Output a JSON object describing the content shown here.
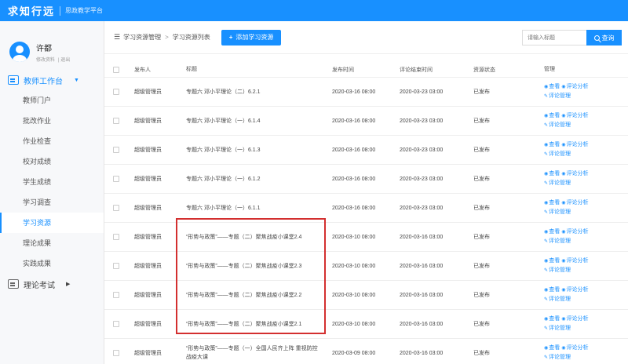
{
  "brand": {
    "title": "求知行远",
    "subtitle": "思政教学平台"
  },
  "user": {
    "name": "许都",
    "link_profile": "修改资料",
    "link_logout": "退出"
  },
  "sidebar": {
    "group_label": "教师工作台",
    "items": [
      {
        "label": "教师门户"
      },
      {
        "label": "批改作业"
      },
      {
        "label": "作业检查"
      },
      {
        "label": "校对成绩"
      },
      {
        "label": "学生成绩"
      },
      {
        "label": "学习调查"
      },
      {
        "label": "学习资源"
      },
      {
        "label": "理论成果"
      },
      {
        "label": "实践成果"
      }
    ],
    "exam_label": "理论考试"
  },
  "breadcrumb": {
    "root": "学习资源管理",
    "current": "学习资源列表"
  },
  "toolbar": {
    "add_label": "添加学习资源"
  },
  "search": {
    "placeholder": "请输入标题",
    "button_label": "查询"
  },
  "table": {
    "headers": {
      "publisher": "发布人",
      "title": "标题",
      "publish_time": "发布时间",
      "end_time": "评论结束时间",
      "status": "资源状态",
      "ops": "管理"
    },
    "ops": {
      "view": "查看",
      "analyze": "评论分析",
      "manage": "评论管理"
    },
    "rows": [
      {
        "publisher": "超级管理员",
        "title": "专题六 邓小平理论（二）6.2.1",
        "publish_time": "2020-03-16 08:00",
        "end_time": "2020-03-23 03:00",
        "status": "已发布"
      },
      {
        "publisher": "超级管理员",
        "title": "专题六 邓小平理论（一）6.1.4",
        "publish_time": "2020-03-16 08:00",
        "end_time": "2020-03-23 03:00",
        "status": "已发布"
      },
      {
        "publisher": "超级管理员",
        "title": "专题六 邓小平理论（一）6.1.3",
        "publish_time": "2020-03-16 08:00",
        "end_time": "2020-03-23 03:00",
        "status": "已发布"
      },
      {
        "publisher": "超级管理员",
        "title": "专题六 邓小平理论（一）6.1.2",
        "publish_time": "2020-03-16 08:00",
        "end_time": "2020-03-23 03:00",
        "status": "已发布"
      },
      {
        "publisher": "超级管理员",
        "title": "专题六 邓小平理论（一）6.1.1",
        "publish_time": "2020-03-16 08:00",
        "end_time": "2020-03-23 03:00",
        "status": "已发布"
      },
      {
        "publisher": "超级管理员",
        "title": "“形势与政策”——专题（二）聚焦战疫小课堂2.4",
        "publish_time": "2020-03-10 08:00",
        "end_time": "2020-03-16 03:00",
        "status": "已发布"
      },
      {
        "publisher": "超级管理员",
        "title": "“形势与政策”——专题（二）聚焦战疫小课堂2.3",
        "publish_time": "2020-03-10 08:00",
        "end_time": "2020-03-16 03:00",
        "status": "已发布"
      },
      {
        "publisher": "超级管理员",
        "title": "“形势与政策”——专题（二）聚焦战疫小课堂2.2",
        "publish_time": "2020-03-10 08:00",
        "end_time": "2020-03-16 03:00",
        "status": "已发布"
      },
      {
        "publisher": "超级管理员",
        "title": "“形势与政策”——专题（二）聚焦战疫小课堂2.1",
        "publish_time": "2020-03-10 08:00",
        "end_time": "2020-03-16 03:00",
        "status": "已发布"
      },
      {
        "publisher": "超级管理员",
        "title": "“形势与政策”——专题（一）全国人民齐上阵 重视防控战疫大课",
        "publish_time": "2020-03-09 08:00",
        "end_time": "2020-03-16 03:00",
        "status": "已发布"
      }
    ]
  }
}
